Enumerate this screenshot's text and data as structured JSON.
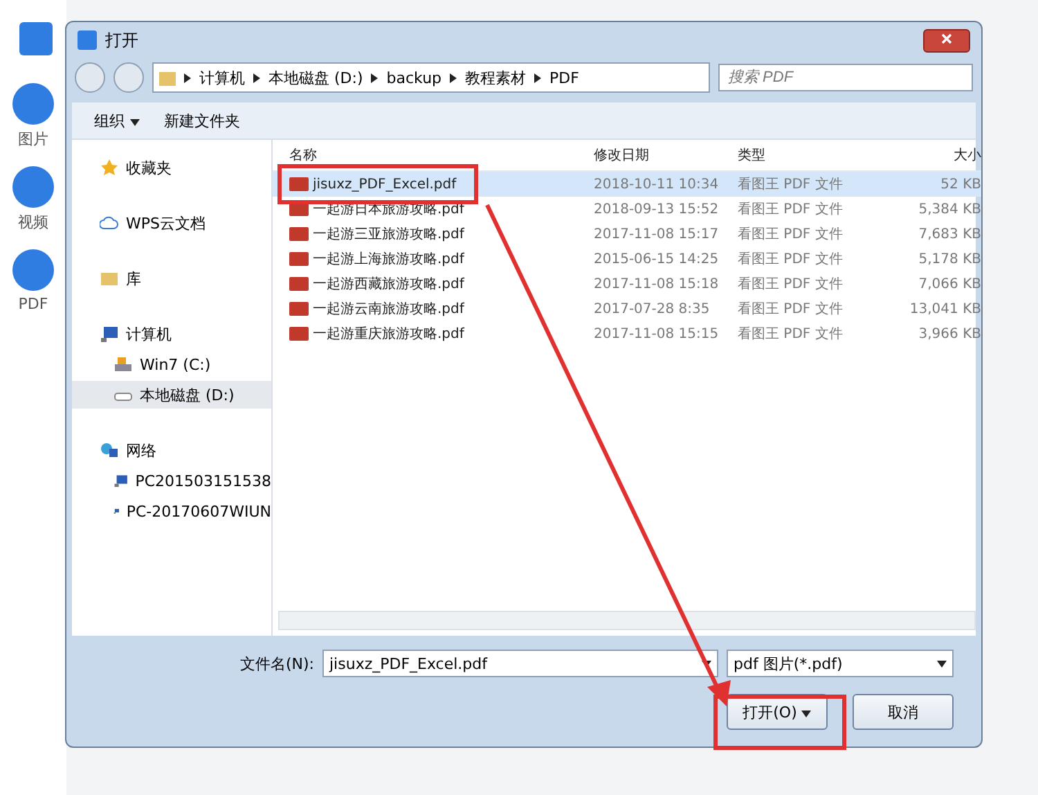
{
  "background_app": {
    "side_items": [
      {
        "label": "图片"
      },
      {
        "label": "视频"
      },
      {
        "label": "PDF"
      }
    ]
  },
  "dialog": {
    "title": "打开",
    "breadcrumb": [
      "计算机",
      "本地磁盘 (D:)",
      "backup",
      "教程素材",
      "PDF"
    ],
    "search": {
      "placeholder": "搜索 PDF"
    },
    "toolbar": {
      "organize": "组织",
      "new_folder": "新建文件夹"
    },
    "nav": [
      {
        "label": "收藏夹",
        "kind": "star",
        "selected": false
      },
      {
        "label": "WPS云文档",
        "kind": "cloud",
        "selected": false
      },
      {
        "label": "库",
        "kind": "library",
        "selected": false
      },
      {
        "label": "计算机",
        "kind": "computer",
        "selected": false,
        "children": [
          {
            "label": "Win7 (C:)",
            "kind": "drive",
            "selected": false
          },
          {
            "label": "本地磁盘 (D:)",
            "kind": "disk",
            "selected": true
          }
        ]
      },
      {
        "label": "网络",
        "kind": "network",
        "selected": false,
        "children": [
          {
            "label": "PC201503151538",
            "kind": "pc",
            "selected": false
          },
          {
            "label": "PC-20170607WIUN",
            "kind": "pc",
            "selected": false
          }
        ]
      }
    ],
    "columns": [
      "名称",
      "修改日期",
      "类型",
      "大小"
    ],
    "files": [
      {
        "name": "jisuxz_PDF_Excel.pdf",
        "date": "2018-10-11 10:34",
        "type": "看图王 PDF 文件",
        "size": "52 KB",
        "selected": true
      },
      {
        "name": "一起游日本旅游攻略.pdf",
        "date": "2018-09-13 15:52",
        "type": "看图王 PDF 文件",
        "size": "5,384 KB",
        "selected": false
      },
      {
        "name": "一起游三亚旅游攻略.pdf",
        "date": "2017-11-08 15:17",
        "type": "看图王 PDF 文件",
        "size": "7,683 KB",
        "selected": false
      },
      {
        "name": "一起游上海旅游攻略.pdf",
        "date": "2015-06-15 14:25",
        "type": "看图王 PDF 文件",
        "size": "5,178 KB",
        "selected": false
      },
      {
        "name": "一起游西藏旅游攻略.pdf",
        "date": "2017-11-08 15:18",
        "type": "看图王 PDF 文件",
        "size": "7,066 KB",
        "selected": false
      },
      {
        "name": "一起游云南旅游攻略.pdf",
        "date": "2017-07-28 8:35",
        "type": "看图王 PDF 文件",
        "size": "13,041 KB",
        "selected": false
      },
      {
        "name": "一起游重庆旅游攻略.pdf",
        "date": "2017-11-08 15:15",
        "type": "看图王 PDF 文件",
        "size": "3,966 KB",
        "selected": false
      }
    ],
    "filename_label": "文件名(N):",
    "filename": "jisuxz_PDF_Excel.pdf",
    "filter": "pdf 图片(*.pdf)",
    "open_button": "打开(O)",
    "cancel_button": "取消"
  }
}
